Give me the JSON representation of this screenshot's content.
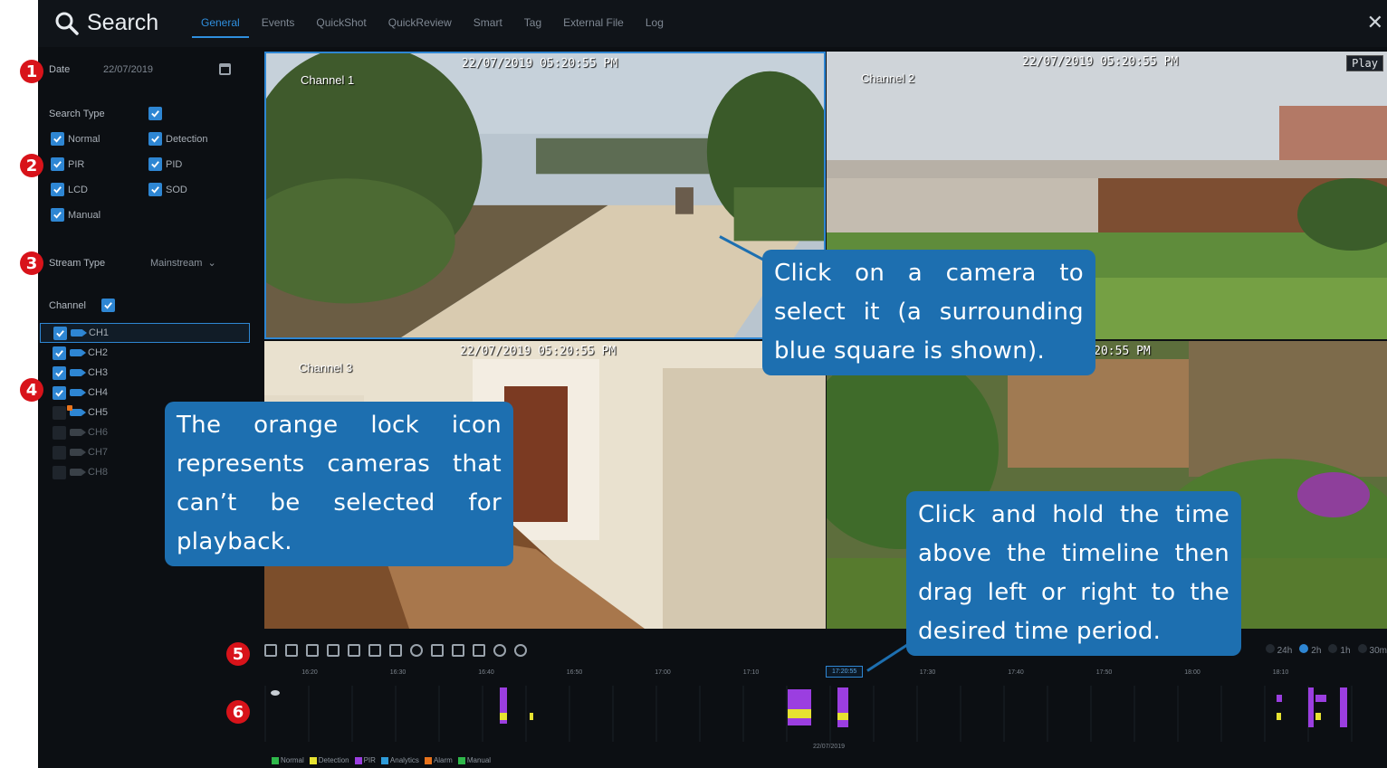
{
  "header": {
    "title": "Search",
    "tabs": [
      {
        "label": "General",
        "active": true
      },
      {
        "label": "Events"
      },
      {
        "label": "QuickShot"
      },
      {
        "label": "QuickReview"
      },
      {
        "label": "Smart"
      },
      {
        "label": "Tag"
      },
      {
        "label": "External File"
      },
      {
        "label": "Log"
      }
    ],
    "close": "✕"
  },
  "sidebar": {
    "date_label": "Date",
    "date_value": "22/07/2019",
    "search_type_label": "Search Type",
    "types": [
      "Normal",
      "Detection",
      "PIR",
      "PID",
      "LCD",
      "SOD",
      "Manual"
    ],
    "stream_type_label": "Stream Type",
    "stream_type_value": "Mainstream",
    "channel_label": "Channel",
    "channels": [
      "CH1",
      "CH2",
      "CH3",
      "CH4",
      "CH5",
      "CH6",
      "CH7",
      "CH8"
    ]
  },
  "video": {
    "timestamp": "22/07/2019 05:20:55 PM",
    "timestamp_partial": "9 05:20:55 PM",
    "channel1": "Channel 1",
    "channel2": "Channel 2",
    "channel3": "Channel 3",
    "play_badge": "Play"
  },
  "timeline": {
    "ticks": [
      "16:20",
      "16:30",
      "16:40",
      "16:50",
      "17:00",
      "17:10",
      "17:20",
      "17:30",
      "17:40",
      "17:50",
      "18:00",
      "18:10"
    ],
    "cursor_time": "17:20:55",
    "date": "22/07/2019",
    "range_options": [
      "24h",
      "2h",
      "1h",
      "30m"
    ],
    "legend": [
      {
        "label": "Normal",
        "color": "#2fb84a"
      },
      {
        "label": "Detection",
        "color": "#e6e231"
      },
      {
        "label": "PIR",
        "color": "#9b3ee0"
      },
      {
        "label": "Analytics",
        "color": "#2e9bd8"
      },
      {
        "label": "Alarm",
        "color": "#e8731c"
      },
      {
        "label": "Manual",
        "color": "#2fb84a"
      }
    ]
  },
  "annotations": {
    "n1": "1",
    "n2": "2",
    "n3": "3",
    "n4": "4",
    "n5": "5",
    "n6": "6",
    "callout_select": "Click on a camera to select it (a surrounding blue square is shown).",
    "callout_lock": "The orange lock icon represents cameras that can’t be selected for playback.",
    "callout_drag": "Click and hold the time above the timeline then drag left or right to the desired time period."
  },
  "colors": {
    "accent": "#2e86d3",
    "callout": "#1d6fb0",
    "badge": "#d8131a"
  }
}
